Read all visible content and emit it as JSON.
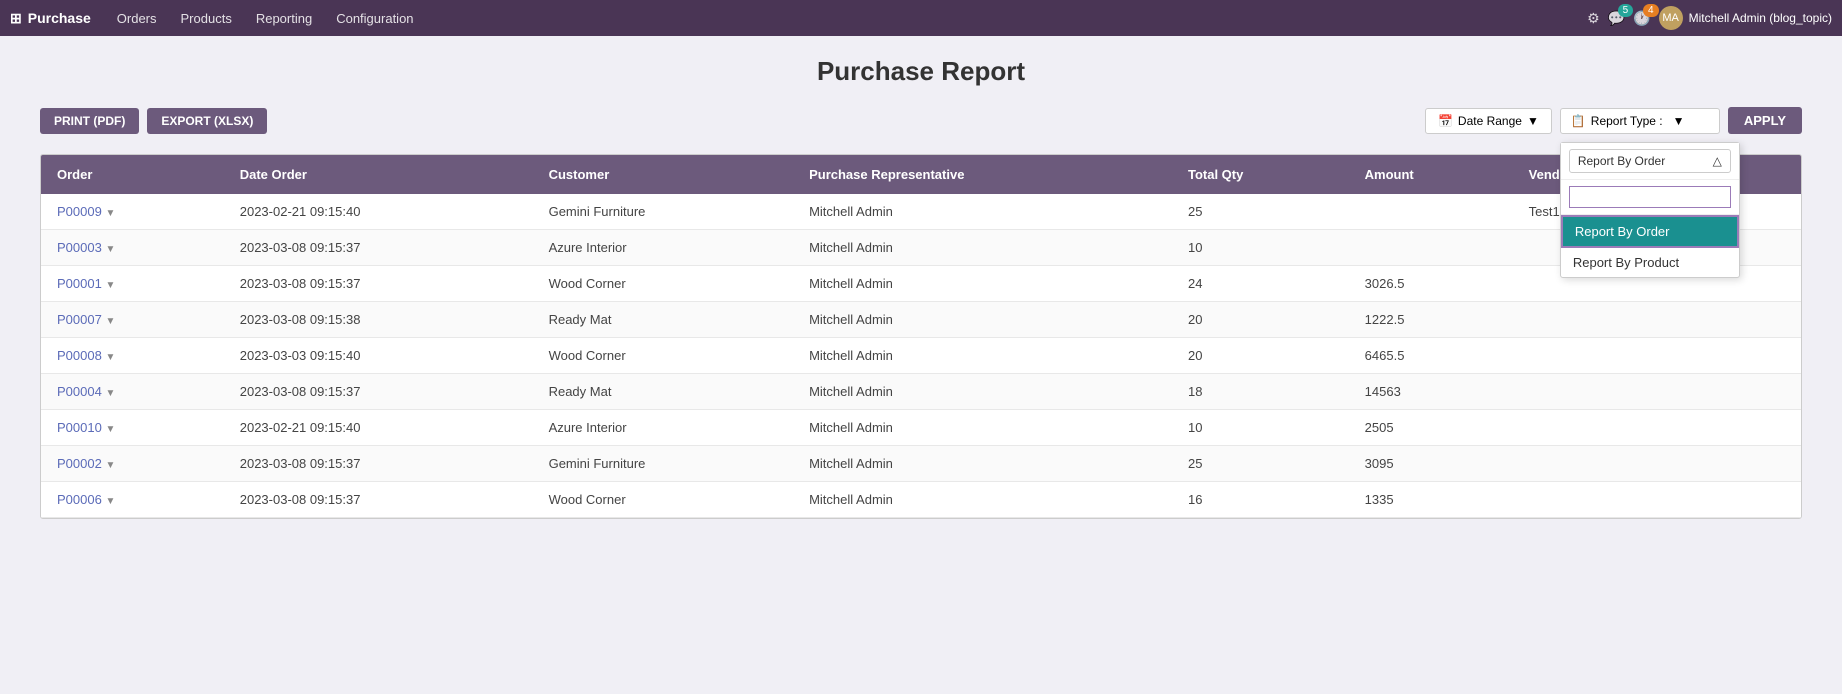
{
  "app": {
    "name": "Purchase",
    "logo_icon": "⊞"
  },
  "nav": {
    "menu_items": [
      "Orders",
      "Products",
      "Reporting",
      "Configuration"
    ]
  },
  "topnav_right": {
    "settings_icon": "⚙",
    "chat_icon": "💬",
    "chat_badge": "5",
    "activity_icon": "🕐",
    "activity_badge": "4",
    "user_name": "Mitchell Admin (blog_topic)",
    "avatar_initials": "MA"
  },
  "page": {
    "title": "Purchase Report"
  },
  "toolbar": {
    "print_btn": "PRINT (PDF)",
    "export_btn": "EXPORT (XLSX)",
    "date_range_label": "Date Range",
    "report_type_label": "Report Type :",
    "report_type_icon": "📋",
    "apply_btn": "APPLY"
  },
  "dropdown": {
    "selected_value": "Report By Order",
    "search_placeholder": "",
    "items": [
      {
        "label": "Report By Order",
        "selected": true
      },
      {
        "label": "Report By Product",
        "selected": false
      }
    ]
  },
  "table": {
    "headers": [
      "Order",
      "Date Order",
      "Customer",
      "Purchase Representative",
      "Total Qty",
      "Amount",
      "Vendor Reference"
    ],
    "rows": [
      {
        "order": "P00009",
        "date_order": "2023-02-21 09:15:40",
        "customer": "Gemini Furniture",
        "rep": "Mitchell Admin",
        "total_qty": "25",
        "amount": "",
        "vendor_ref": "Test12345"
      },
      {
        "order": "P00003",
        "date_order": "2023-03-08 09:15:37",
        "customer": "Azure Interior",
        "rep": "Mitchell Admin",
        "total_qty": "10",
        "amount": "",
        "vendor_ref": ""
      },
      {
        "order": "P00001",
        "date_order": "2023-03-08 09:15:37",
        "customer": "Wood Corner",
        "rep": "Mitchell Admin",
        "total_qty": "24",
        "amount": "3026.5",
        "vendor_ref": ""
      },
      {
        "order": "P00007",
        "date_order": "2023-03-08 09:15:38",
        "customer": "Ready Mat",
        "rep": "Mitchell Admin",
        "total_qty": "20",
        "amount": "1222.5",
        "vendor_ref": ""
      },
      {
        "order": "P00008",
        "date_order": "2023-03-03 09:15:40",
        "customer": "Wood Corner",
        "rep": "Mitchell Admin",
        "total_qty": "20",
        "amount": "6465.5",
        "vendor_ref": ""
      },
      {
        "order": "P00004",
        "date_order": "2023-03-08 09:15:37",
        "customer": "Ready Mat",
        "rep": "Mitchell Admin",
        "total_qty": "18",
        "amount": "14563",
        "vendor_ref": ""
      },
      {
        "order": "P00010",
        "date_order": "2023-02-21 09:15:40",
        "customer": "Azure Interior",
        "rep": "Mitchell Admin",
        "total_qty": "10",
        "amount": "2505",
        "vendor_ref": ""
      },
      {
        "order": "P00002",
        "date_order": "2023-03-08 09:15:37",
        "customer": "Gemini Furniture",
        "rep": "Mitchell Admin",
        "total_qty": "25",
        "amount": "3095",
        "vendor_ref": ""
      },
      {
        "order": "P00006",
        "date_order": "2023-03-08 09:15:37",
        "customer": "Wood Corner",
        "rep": "Mitchell Admin",
        "total_qty": "16",
        "amount": "1335",
        "vendor_ref": ""
      }
    ]
  }
}
